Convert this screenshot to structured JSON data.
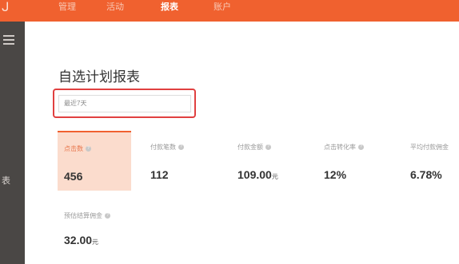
{
  "nav": {
    "items": [
      {
        "label": "管理"
      },
      {
        "label": "活动"
      },
      {
        "label": "报表"
      },
      {
        "label": "账户"
      }
    ]
  },
  "sidebar": {
    "label": "表"
  },
  "page": {
    "title": "自选计划报表"
  },
  "date_filter": {
    "value": "最近7天"
  },
  "metrics": [
    {
      "label": "点击数",
      "value": "456",
      "unit": ""
    },
    {
      "label": "付款笔数",
      "value": "112",
      "unit": ""
    },
    {
      "label": "付款金额",
      "value": "109.00",
      "unit": "元"
    },
    {
      "label": "点击转化率",
      "value": "12%",
      "unit": ""
    },
    {
      "label": "平均付款佣金",
      "value": "6.78%",
      "unit": ""
    },
    {
      "label": "预估结算佣金",
      "value": "32.00",
      "unit": "元"
    }
  ],
  "colors": {
    "accent": "#f0612f",
    "sidebar": "#4a4745",
    "highlight": "#e04040"
  }
}
